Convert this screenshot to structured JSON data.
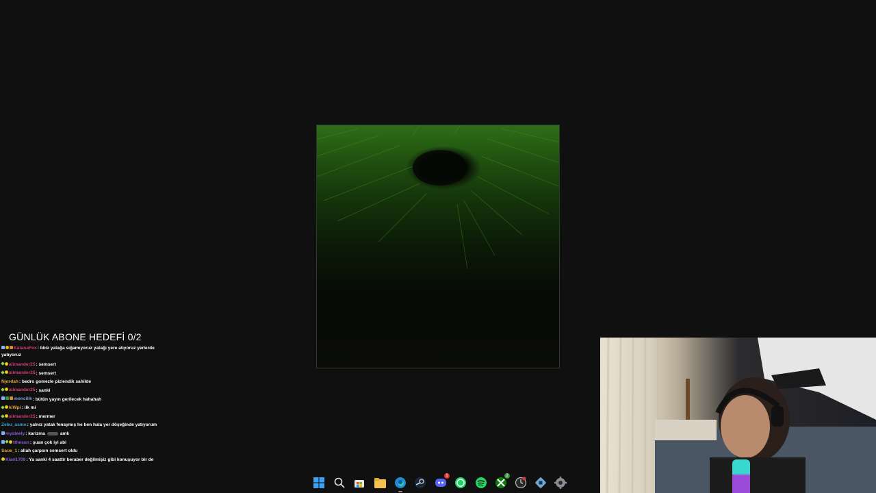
{
  "overlay": {
    "goal_text": "GÜNLÜK ABONE HEDEFİ 0/2"
  },
  "colors": {
    "background": "#101010",
    "viewer_green": "#2f6d18",
    "chat_text": "#ffffff"
  },
  "chat": {
    "messages": [
      {
        "user": "KatanaFox",
        "user_color": "#d13b78",
        "badges": [
          "sub",
          "vip",
          "gift"
        ],
        "text": ": bbiz yatağa sığamıyoruz yatağı yere atıyoruz yerlerde yatıyoruz"
      },
      {
        "user": "alimander25",
        "user_color": "#d13b78",
        "badges": [
          "dia",
          "vip"
        ],
        "text": ": semsert"
      },
      {
        "user": "alimander25",
        "user_color": "#d13b78",
        "badges": [
          "dia",
          "vip"
        ],
        "text": ": semsert"
      },
      {
        "user": "Njordah",
        "user_color": "#e0a63c",
        "badges": [],
        "text": ": bedro gomezle pizlendik sahilde"
      },
      {
        "user": "alimander25",
        "user_color": "#d13b78",
        "badges": [
          "dia",
          "vip"
        ],
        "text": ": sanki"
      },
      {
        "user": "moncilik",
        "user_color": "#7f9fe0",
        "badges": [
          "sub",
          "mod",
          "gift"
        ],
        "text": ": bütün yayın gerilecek hahahah"
      },
      {
        "user": "kiWpi",
        "user_color": "#e0a63c",
        "badges": [
          "dia",
          "vip"
        ],
        "text": ": ilk mi"
      },
      {
        "user": "alimander25",
        "user_color": "#d13b78",
        "badges": [
          "dia",
          "vip"
        ],
        "text": ": mermer"
      },
      {
        "user": "Zebu_asmo",
        "user_color": "#3aa0d9",
        "badges": [],
        "text": ": yalnız yatak fenaymış he ben hala yer döşeğinde yatıyorum"
      },
      {
        "user": "mysteely",
        "user_color": "#8b5cd6",
        "badges": [
          "sub"
        ],
        "text": ": karizma",
        "emote": true,
        "after": "amk"
      },
      {
        "user": "tthesun",
        "user_color": "#8b5cd6",
        "badges": [
          "sub",
          "dia",
          "vip"
        ],
        "text": ": şuan çok iyi abi"
      },
      {
        "user": "Saue_1",
        "user_color": "#e0a63c",
        "badges": [],
        "text": ": allah çarpsın semsert oldu"
      },
      {
        "user": "Kiari1709",
        "user_color": "#8b5cd6",
        "badges": [
          "vip"
        ],
        "text": ": Ya sanki 4 saattir beraber değilmişiz gibi konuşuyor bir de"
      }
    ]
  },
  "taskbar": {
    "icons": [
      {
        "name": "windows-start-icon",
        "badge": ""
      },
      {
        "name": "search-icon",
        "badge": ""
      },
      {
        "name": "microsoft-store-icon",
        "badge": ""
      },
      {
        "name": "file-explorer-icon",
        "badge": ""
      },
      {
        "name": "edge-browser-icon",
        "badge": ""
      },
      {
        "name": "steam-icon",
        "badge": ""
      },
      {
        "name": "discord-icon",
        "badge": "1"
      },
      {
        "name": "whatsapp-icon",
        "badge": ""
      },
      {
        "name": "spotify-icon",
        "badge": ""
      },
      {
        "name": "xbox-icon",
        "badge": "2"
      },
      {
        "name": "clock-app-icon",
        "badge": ""
      },
      {
        "name": "network-app-icon",
        "badge": ""
      },
      {
        "name": "settings-gear-icon",
        "badge": ""
      }
    ]
  }
}
